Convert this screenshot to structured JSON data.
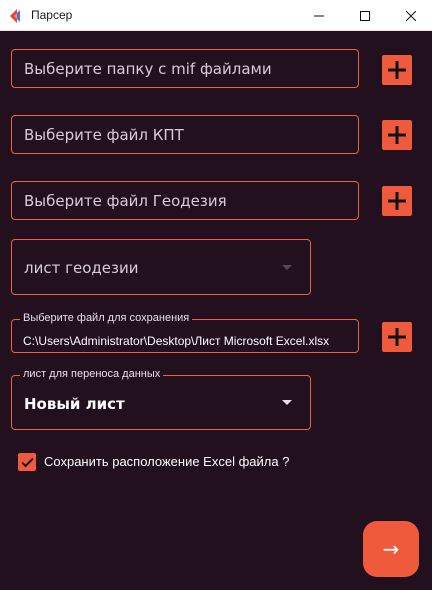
{
  "window": {
    "title": "Парсер"
  },
  "fields": {
    "mif_folder": {
      "placeholder": "Выберите папку с mif файлами"
    },
    "kpt_file": {
      "placeholder": "Выберите файл КПТ"
    },
    "geodesy_file": {
      "placeholder": "Выберите файл Геодезия"
    },
    "geodesy_sheet": {
      "placeholder": "лист геодезии"
    },
    "save_file": {
      "label": "Выберите файл для сохранения",
      "value": "C:\\Users\\Administrator\\Desktop\\Лист Microsoft Excel.xlsx"
    },
    "target_sheet": {
      "label": "лист для переноса данных",
      "value": "Новый лист"
    }
  },
  "checkbox": {
    "label": "Сохранить расположение Excel файла ?",
    "checked": true
  },
  "fab": {
    "icon": "arrow-right-icon",
    "glyph": "→"
  },
  "colors": {
    "accent": "#ef5a3c",
    "background": "#22101f",
    "border": "#ec6147"
  }
}
